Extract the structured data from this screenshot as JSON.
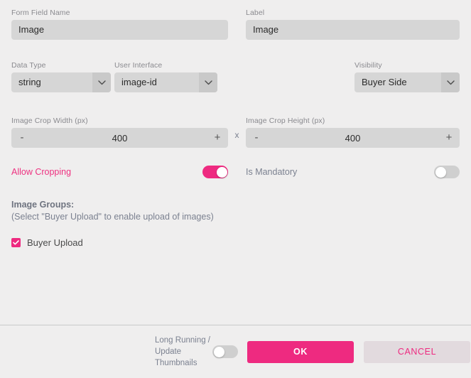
{
  "form": {
    "form_field_name": {
      "label": "Form Field Name",
      "value": "Image"
    },
    "label_field": {
      "label": "Label",
      "value": "Image"
    },
    "data_type": {
      "label": "Data Type",
      "value": "string"
    },
    "user_interface": {
      "label": "User Interface",
      "value": "image-id"
    },
    "visibility": {
      "label": "Visibility",
      "value": "Buyer Side"
    },
    "crop_width": {
      "label": "Image Crop Width (px)",
      "value": "400",
      "minus": "-",
      "plus": "+"
    },
    "crop_height": {
      "label": "Image Crop Height (px)",
      "value": "400",
      "minus": "-",
      "plus": "+"
    },
    "dimension_separator": "x",
    "allow_cropping": {
      "label": "Allow Cropping",
      "state": "on"
    },
    "is_mandatory": {
      "label": "Is Mandatory",
      "state": "off"
    },
    "image_groups": {
      "title": "Image Groups:",
      "hint": "(Select \"Buyer Upload\" to enable upload of images)",
      "options": [
        {
          "label": "Buyer Upload",
          "checked": true
        }
      ]
    }
  },
  "footer": {
    "long_running_label": "Long Running / Update Thumbnails",
    "long_running_line1": "Long Running /",
    "long_running_line2": "Update",
    "long_running_line3": "Thumbnails",
    "long_running_state": "off",
    "ok_label": "OK",
    "cancel_label": "CANCEL"
  },
  "colors": {
    "accent_pink": "#ee2a80",
    "page_background": "#efeeee",
    "input_background": "#d6d6d6",
    "cancel_background": "#e2dade",
    "label_gray": "#8a8a8f"
  }
}
